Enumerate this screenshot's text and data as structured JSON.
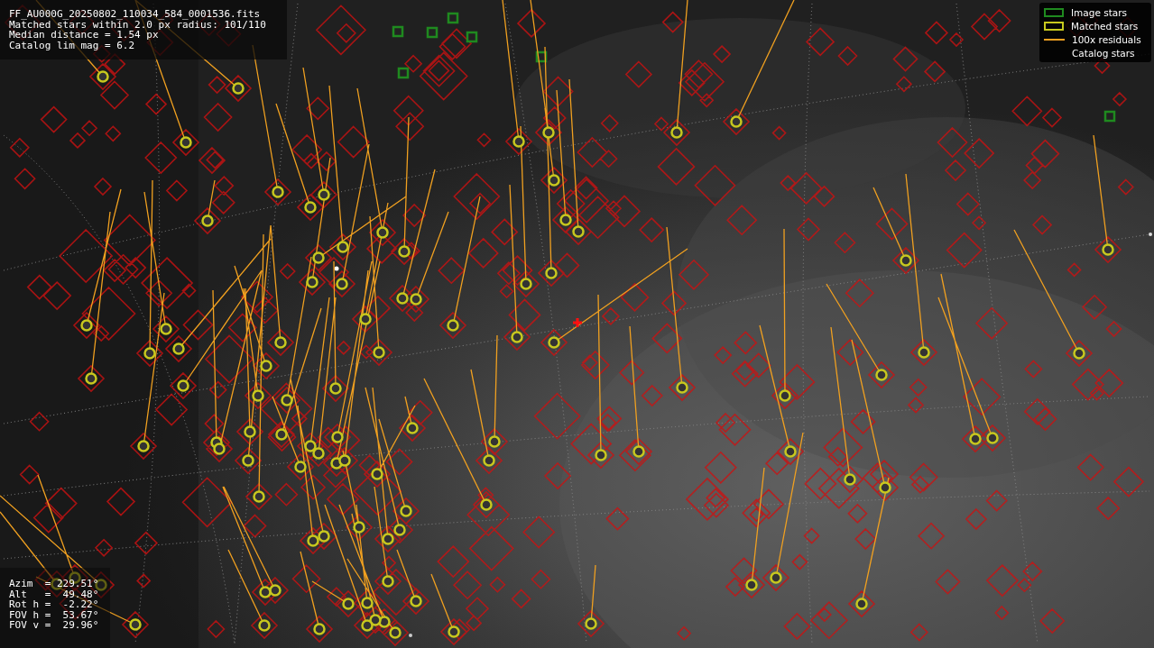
{
  "header": {
    "lines": [
      "FF_AU000G_20250802_110034_584_0001536.fits",
      "Matched stars within 2.0 px radius: 101/110",
      "Median distance = 1.54 px",
      "Catalog lim mag = 6.2"
    ]
  },
  "legend": {
    "items": [
      {
        "label": "Image stars",
        "color": "#1f8a1f"
      },
      {
        "kind": "matched",
        "label": "Matched stars",
        "color": "#c8c81e"
      },
      {
        "kind": "residual",
        "label": "100x residuals",
        "color": "#f0a020"
      },
      {
        "kind": "catalog",
        "label": "Catalog stars"
      }
    ]
  },
  "pointing": {
    "lines": [
      "Azim  = 229.51°",
      "Alt   =  49.48°",
      "Rot h =  -2.22°",
      "FOV h =  53.67°",
      "FOV v =  29.96°"
    ]
  }
}
